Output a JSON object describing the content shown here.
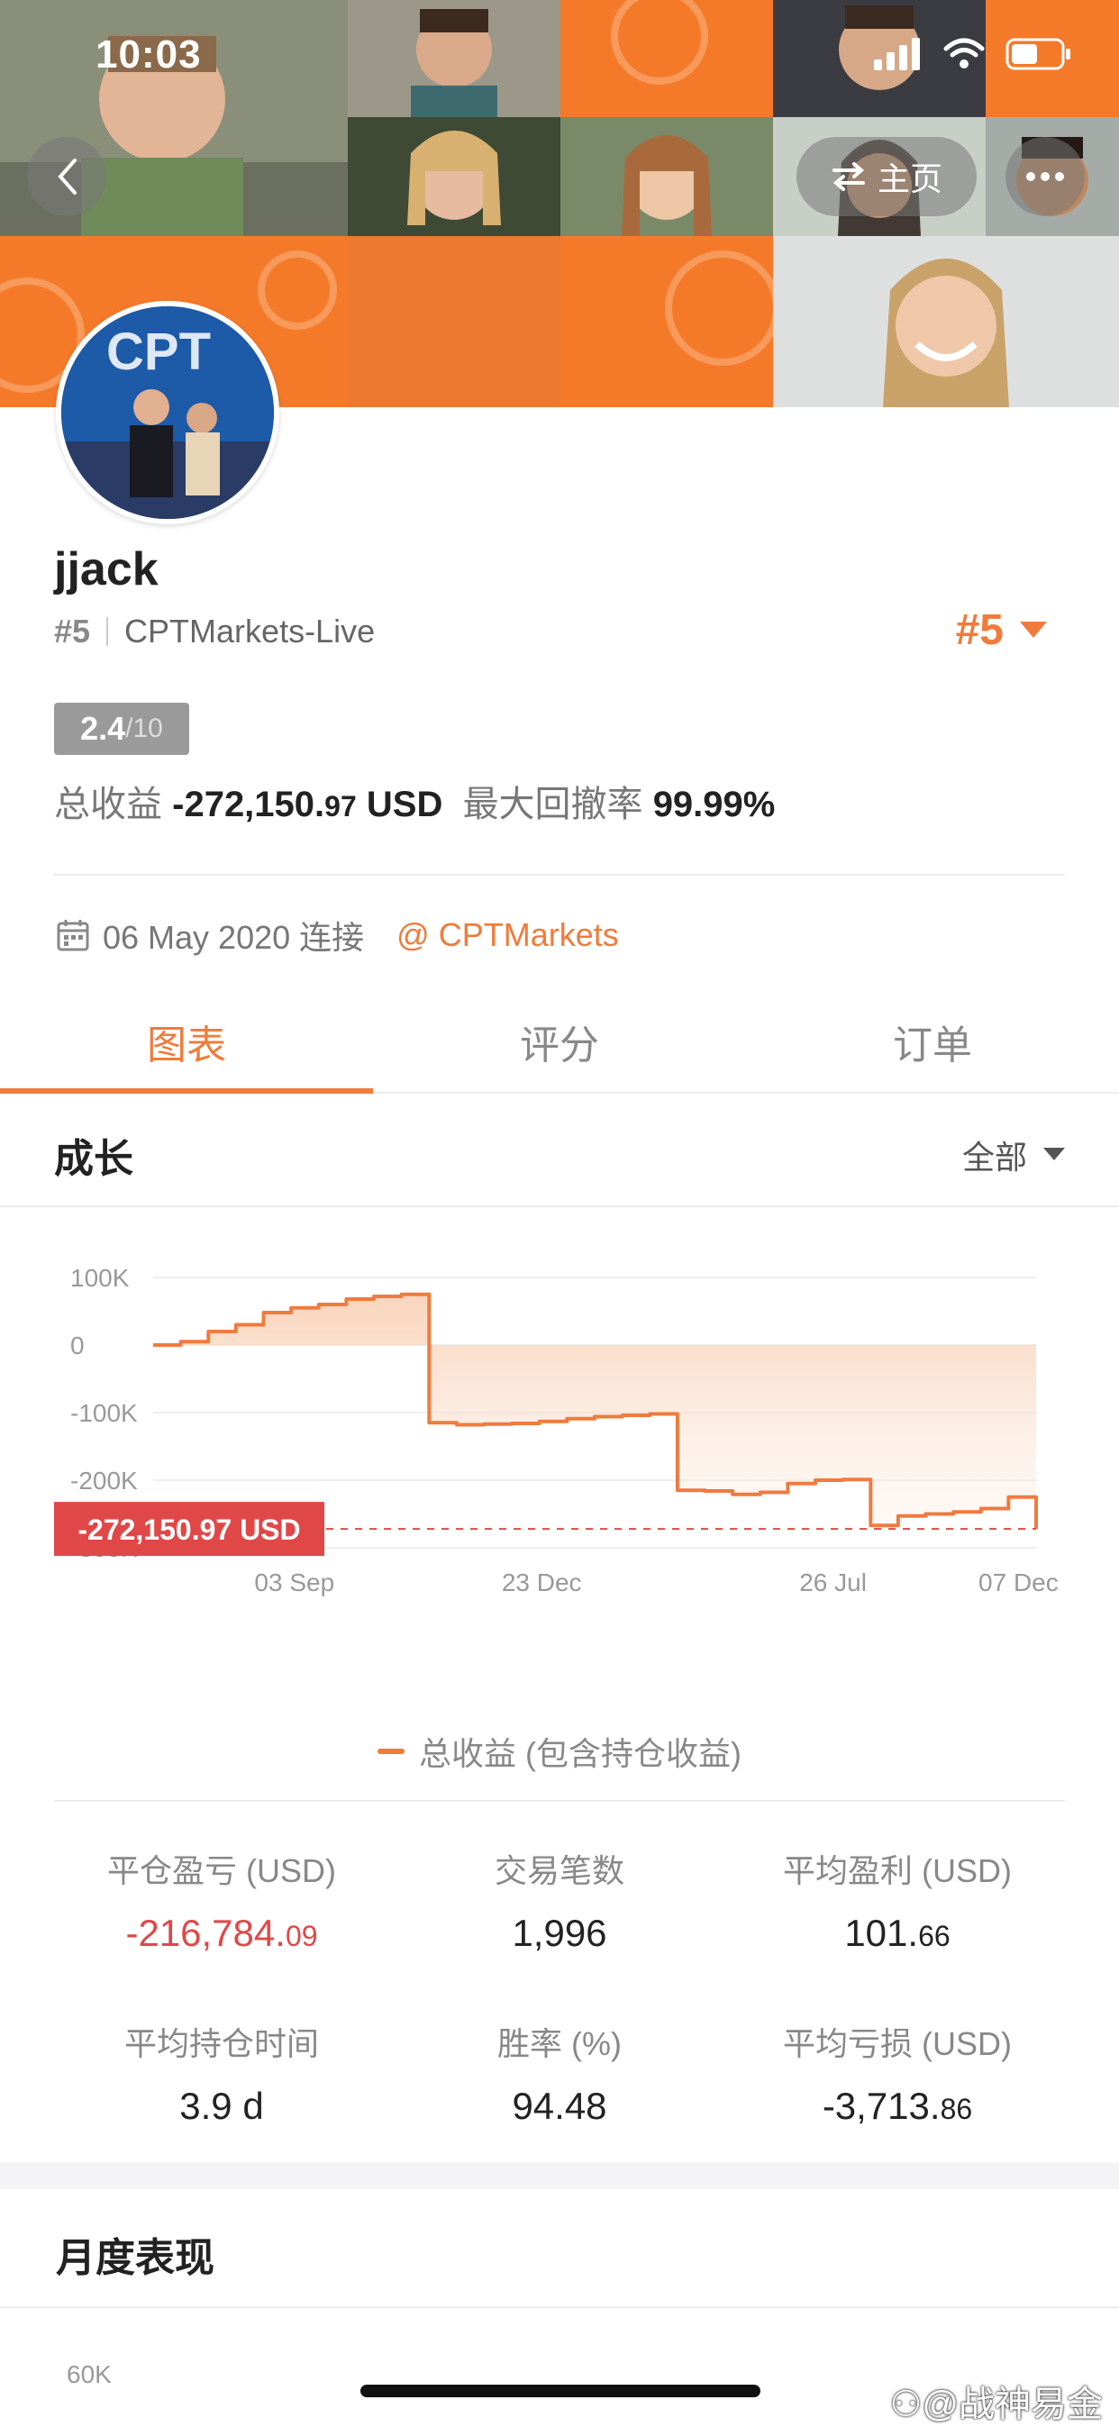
{
  "status_bar": {
    "time": "10:03",
    "icons": [
      "signal-icon",
      "wifi-icon",
      "battery-icon"
    ]
  },
  "header": {
    "back_icon": "chevron-left-icon",
    "switch_label": "主页",
    "switch_icon": "swap-arrows-icon",
    "more_icon": "more-icon"
  },
  "profile": {
    "username": "jjack",
    "rank": "#5",
    "broker": "CPTMarkets-Live",
    "rank_big": "#5",
    "score_main": "2.4",
    "score_den": "/10",
    "total_profit_label": "总收益",
    "total_profit_int": "-272,150.",
    "total_profit_dec": "97",
    "total_profit_unit": "USD",
    "max_drawdown_label": "最大回撤率",
    "max_drawdown": "99.99%",
    "join_date": "06 May 2020 连接",
    "broker_link": "@ CPTMarkets"
  },
  "tabs": [
    {
      "label": "图表"
    },
    {
      "label": "评分"
    },
    {
      "label": "订单"
    }
  ],
  "growth": {
    "title": "成长",
    "filter": "全部",
    "current_value_label": "-272,150.97 USD"
  },
  "chart_data": {
    "type": "area",
    "y_ticks": [
      "100K",
      "0",
      "-100K",
      "-200K",
      "-300K"
    ],
    "x_ticks": [
      "03 Sep",
      "23 Dec",
      "26 Jul",
      "07 Dec"
    ],
    "ylim": [
      -300000,
      100000
    ],
    "series": [
      {
        "name": "总收益 (包含持仓收益)",
        "values": [
          0,
          5000,
          20000,
          30000,
          48000,
          55000,
          60000,
          68000,
          72000,
          75000,
          -115000,
          -118000,
          -117000,
          -116000,
          -113000,
          -109000,
          -106000,
          -104000,
          -102000,
          -215000,
          -216000,
          -221000,
          -218000,
          -205000,
          -200000,
          -199000,
          -267000,
          -253000,
          -250000,
          -247000,
          -242000,
          -225000,
          -272150.97
        ]
      }
    ],
    "grid": true,
    "current_line": -272150.97
  },
  "legend": {
    "label": "总收益 (包含持仓收益)"
  },
  "stats": [
    {
      "label": "平仓盈亏 (USD)",
      "int": "-216,784.",
      "dec": "09",
      "negative": true
    },
    {
      "label": "交易笔数",
      "int": "1,996",
      "dec": ""
    },
    {
      "label": "平均盈利 (USD)",
      "int": "101.",
      "dec": "66"
    },
    {
      "label": "平均持仓时间",
      "int": "3.9 d",
      "dec": ""
    },
    {
      "label": "胜率 (%)",
      "int": "94.48",
      "dec": ""
    },
    {
      "label": "平均亏损 (USD)",
      "int": "-3,713.",
      "dec": "86"
    }
  ],
  "monthly": {
    "title": "月度表现",
    "first_tick": "60K"
  },
  "watermark": "⚇@战神易金"
}
